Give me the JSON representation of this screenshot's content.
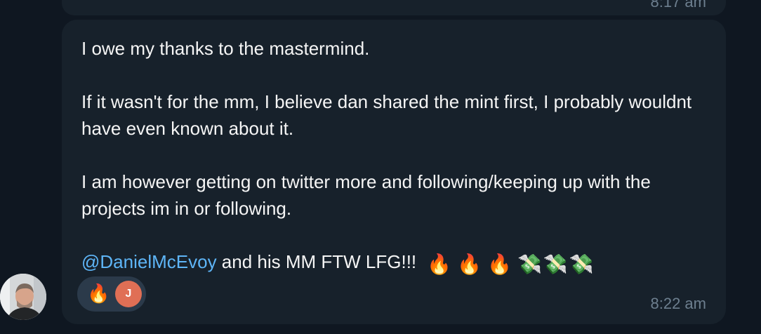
{
  "previous_message": {
    "time": "8:17 am"
  },
  "message": {
    "line1": "I owe my thanks to the mastermind.",
    "line2": "If it wasn't for the mm, I believe dan shared the mint first, I probably wouldnt have even known about it.",
    "line3": "I am however getting on twitter more and following/keeping up with the projects im in or following.",
    "mention": "@DanielMcEvoy",
    "line4_text": " and his MM FTW LFG!!! ",
    "emojis": [
      "🔥",
      "🔥",
      "🔥",
      "💸",
      "💸",
      "💸"
    ],
    "time": "8:22 am"
  },
  "reaction": {
    "emoji": "🔥",
    "user_initial": "J",
    "user_color": "#e06f55"
  },
  "sender_avatar": {
    "description": "person-avatar"
  },
  "colors": {
    "background": "#0f1721",
    "bubble": "#17212b",
    "mention": "#5eb5f7",
    "timestamp": "#6d7f8f"
  }
}
